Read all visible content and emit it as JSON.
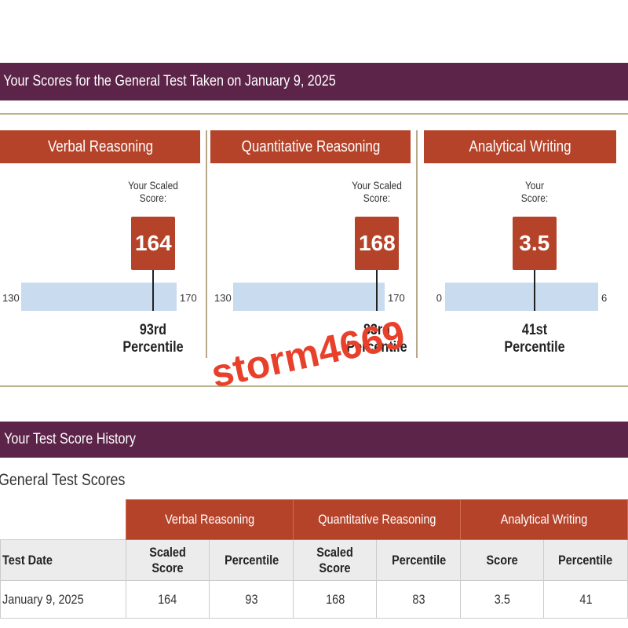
{
  "header": {
    "title": "Your Scores for the General Test Taken on January 9, 2025"
  },
  "panels": [
    {
      "title": "Verbal Reasoning",
      "label_line1": "Your Scaled",
      "label_line2": "Score:",
      "score": "164",
      "min": "130",
      "max": "170",
      "percentile_value": "93rd",
      "percentile_label": "Percentile",
      "score_num": 164,
      "min_num": 130,
      "max_num": 170
    },
    {
      "title": "Quantitative Reasoning",
      "label_line1": "Your Scaled",
      "label_line2": "Score:",
      "score": "168",
      "min": "130",
      "max": "170",
      "percentile_value": "83rd",
      "percentile_label": "Percentile",
      "score_num": 168,
      "min_num": 130,
      "max_num": 170
    },
    {
      "title": "Analytical Writing",
      "label_line1": "Your",
      "label_line2": "Score:",
      "score": "3.5",
      "min": "0",
      "max": "6",
      "percentile_value": "41st",
      "percentile_label": "Percentile",
      "score_num": 3.5,
      "min_num": 0,
      "max_num": 6
    }
  ],
  "watermark": "storm4669",
  "history": {
    "title": "Your Test Score History",
    "subtitle": "General Test Scores",
    "groups": [
      "Verbal Reasoning",
      "Quantitative Reasoning",
      "Analytical Writing"
    ],
    "columns": [
      "Test Date",
      "Scaled Score",
      "Percentile",
      "Scaled Score",
      "Percentile",
      "Score",
      "Percentile"
    ],
    "rows": [
      [
        "January 9, 2025",
        "164",
        "93",
        "168",
        "83",
        "3.5",
        "41"
      ]
    ]
  },
  "colors": {
    "header": "#5d2449",
    "accent": "#b5432a",
    "scale": "#c9dbee"
  }
}
